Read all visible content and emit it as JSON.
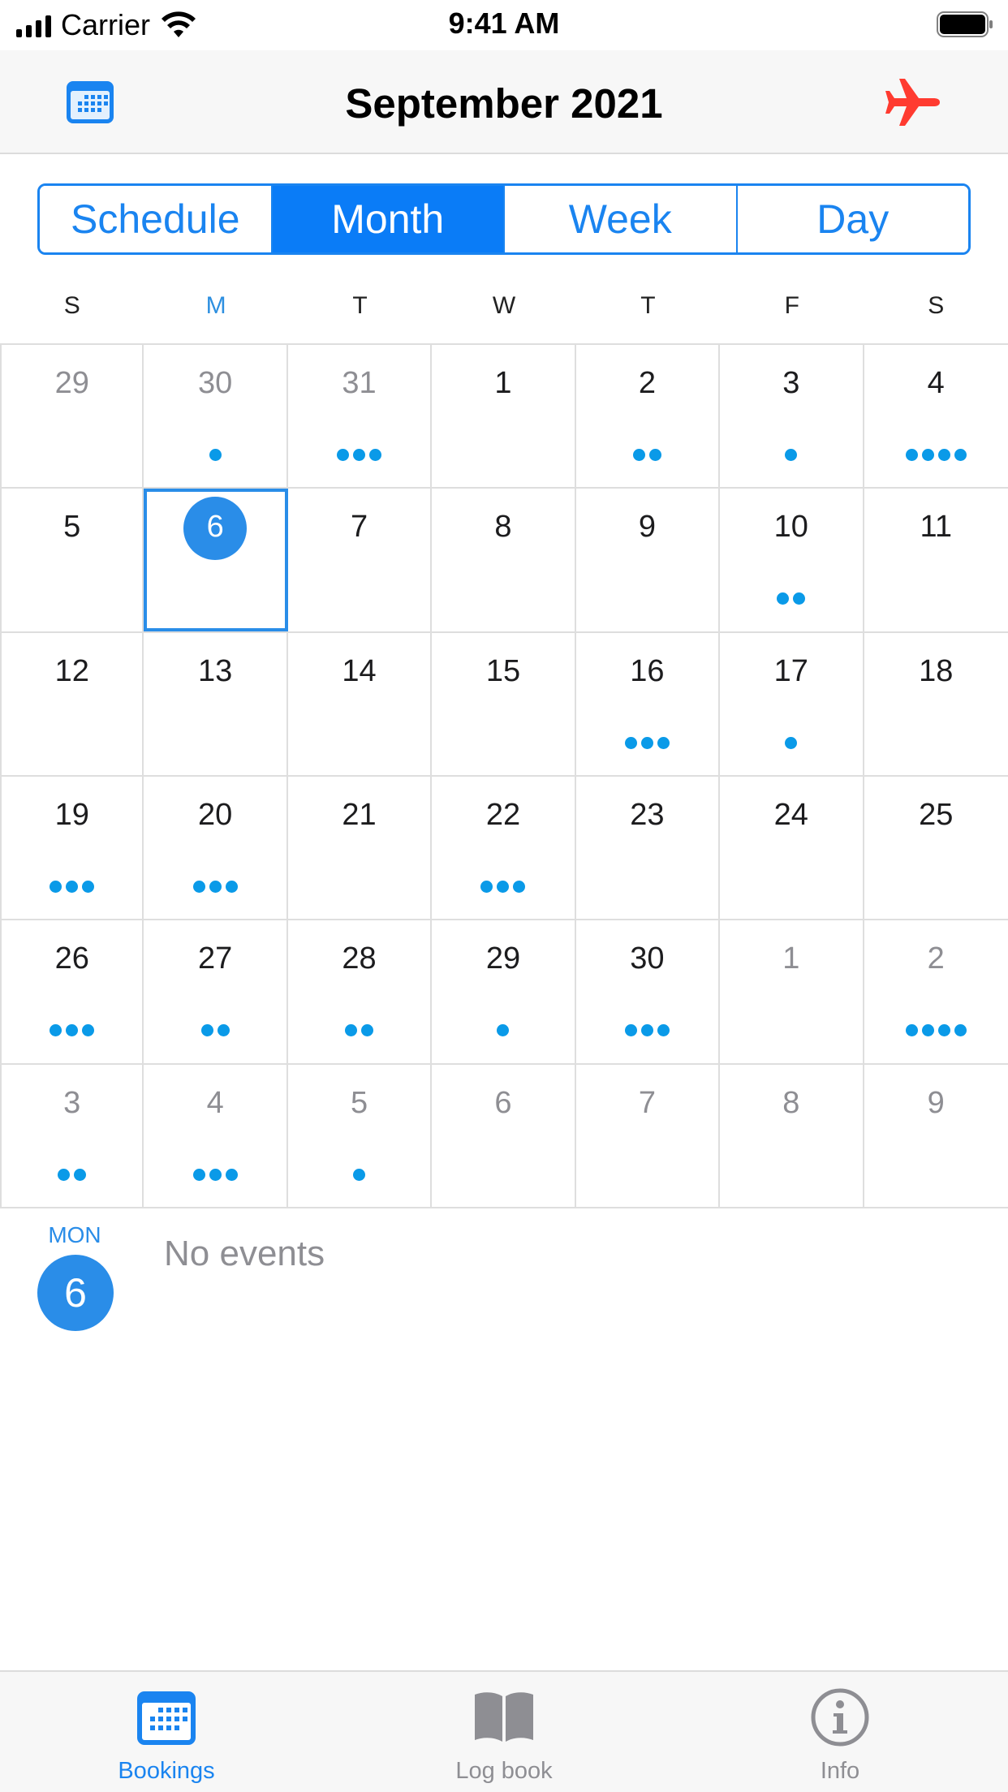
{
  "status_bar": {
    "carrier": "Carrier",
    "time": "9:41 AM"
  },
  "nav": {
    "title": "September 2021",
    "left_icon": "calendar-icon",
    "right_icon": "airplane-icon",
    "right_icon_color": "#ff3b30"
  },
  "segments": [
    {
      "label": "Schedule",
      "active": false
    },
    {
      "label": "Month",
      "active": true
    },
    {
      "label": "Week",
      "active": false
    },
    {
      "label": "Day",
      "active": false
    }
  ],
  "weekdays": [
    "S",
    "M",
    "T",
    "W",
    "T",
    "F",
    "S"
  ],
  "current_weekday_index": 1,
  "calendar": {
    "weeks": [
      [
        {
          "day": "29",
          "other": true,
          "dots": 0
        },
        {
          "day": "30",
          "other": true,
          "dots": 1
        },
        {
          "day": "31",
          "other": true,
          "dots": 3
        },
        {
          "day": "1",
          "other": false,
          "dots": 0
        },
        {
          "day": "2",
          "other": false,
          "dots": 2
        },
        {
          "day": "3",
          "other": false,
          "dots": 1
        },
        {
          "day": "4",
          "other": false,
          "dots": 4
        }
      ],
      [
        {
          "day": "5",
          "other": false,
          "dots": 0
        },
        {
          "day": "6",
          "other": false,
          "dots": 0,
          "selected": true
        },
        {
          "day": "7",
          "other": false,
          "dots": 0
        },
        {
          "day": "8",
          "other": false,
          "dots": 0
        },
        {
          "day": "9",
          "other": false,
          "dots": 0
        },
        {
          "day": "10",
          "other": false,
          "dots": 2
        },
        {
          "day": "11",
          "other": false,
          "dots": 0
        }
      ],
      [
        {
          "day": "12",
          "other": false,
          "dots": 0
        },
        {
          "day": "13",
          "other": false,
          "dots": 0
        },
        {
          "day": "14",
          "other": false,
          "dots": 0
        },
        {
          "day": "15",
          "other": false,
          "dots": 0
        },
        {
          "day": "16",
          "other": false,
          "dots": 3
        },
        {
          "day": "17",
          "other": false,
          "dots": 1
        },
        {
          "day": "18",
          "other": false,
          "dots": 0
        }
      ],
      [
        {
          "day": "19",
          "other": false,
          "dots": 3
        },
        {
          "day": "20",
          "other": false,
          "dots": 3
        },
        {
          "day": "21",
          "other": false,
          "dots": 0
        },
        {
          "day": "22",
          "other": false,
          "dots": 3
        },
        {
          "day": "23",
          "other": false,
          "dots": 0
        },
        {
          "day": "24",
          "other": false,
          "dots": 0
        },
        {
          "day": "25",
          "other": false,
          "dots": 0
        }
      ],
      [
        {
          "day": "26",
          "other": false,
          "dots": 3
        },
        {
          "day": "27",
          "other": false,
          "dots": 2
        },
        {
          "day": "28",
          "other": false,
          "dots": 2
        },
        {
          "day": "29",
          "other": false,
          "dots": 1
        },
        {
          "day": "30",
          "other": false,
          "dots": 3
        },
        {
          "day": "1",
          "other": true,
          "dots": 0
        },
        {
          "day": "2",
          "other": true,
          "dots": 4
        }
      ],
      [
        {
          "day": "3",
          "other": true,
          "dots": 2
        },
        {
          "day": "4",
          "other": true,
          "dots": 3
        },
        {
          "day": "5",
          "other": true,
          "dots": 1
        },
        {
          "day": "6",
          "other": true,
          "dots": 0
        },
        {
          "day": "7",
          "other": true,
          "dots": 0
        },
        {
          "day": "8",
          "other": true,
          "dots": 0
        },
        {
          "day": "9",
          "other": true,
          "dots": 0
        }
      ]
    ]
  },
  "detail": {
    "dow": "MON",
    "day": "6",
    "message": "No events"
  },
  "tabs": [
    {
      "label": "Bookings",
      "icon": "calendar-icon",
      "active": true
    },
    {
      "label": "Log book",
      "icon": "book-icon",
      "active": false
    },
    {
      "label": "Info",
      "icon": "info-icon",
      "active": false
    }
  ],
  "colors": {
    "accent": "#1a84f0",
    "dot": "#0a9ae8",
    "selected": "#2a8de8"
  }
}
